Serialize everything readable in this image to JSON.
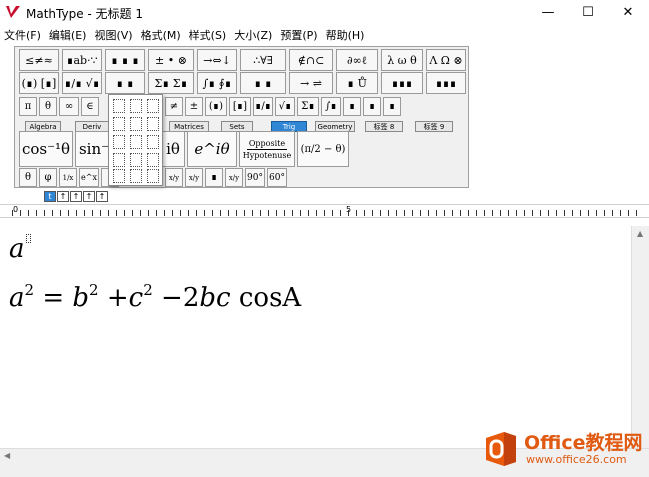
{
  "window": {
    "title": "MathType - 无标题 1",
    "minimize_glyph": "—",
    "maximize_glyph": "☐",
    "close_glyph": "✕"
  },
  "menu": [
    "文件(F)",
    "编辑(E)",
    "视图(V)",
    "格式(M)",
    "样式(S)",
    "大小(Z)",
    "预置(P)",
    "帮助(H)"
  ],
  "palette_row1": [
    "≤≠≈",
    "∎ab·∵",
    "∎ ∎ ∎",
    "± • ⊗",
    "→⇔↓",
    "∴∀∃",
    "∉∩⊂",
    "∂∞ℓ",
    "λ ω θ",
    "Λ Ω ⊗"
  ],
  "palette_row2": [
    "(∎) [∎]",
    "∎/∎ √∎",
    "∎ ∎",
    "Σ∎ Σ∎",
    "∫∎ ∮∎",
    "∎ ∎",
    "→ ⇌",
    "∎ Ů",
    "∎∎∎",
    "∎∎∎"
  ],
  "palette_row3": [
    "π",
    "θ",
    "∞",
    "∈",
    "≠",
    "±",
    "(∎)",
    "[∎]",
    "∎/∎",
    "√∎",
    "Σ∎",
    "∫∎",
    "∎",
    "∎",
    "∎"
  ],
  "tabs": [
    "Algebra",
    "Deriv",
    "Matrices",
    "Sets",
    "Trig",
    "Geometry",
    "标签 8",
    "标签 9"
  ],
  "active_tab": "Trig",
  "template_row": {
    "cos_inv": "cos⁻¹θ",
    "sin_inv": "sin⁻¹",
    "i_theta": "iθ",
    "e_i_theta": "e^iθ",
    "opposite": "Opposite",
    "hypotenuse": "Hypotenuse",
    "pi_half_minus_theta": "(π/2 − θ)"
  },
  "small_row": [
    "θ",
    "φ",
    "1/x",
    "e^x",
    "∎",
    "x/y",
    "x/y",
    "∎",
    "x/y",
    "90°",
    "60°"
  ],
  "size_buttons": [
    "t",
    "↑",
    "↑",
    "↑",
    "↑"
  ],
  "ruler": {
    "mark_0": "0",
    "mark_5": "5"
  },
  "document": {
    "line1_base": "a",
    "line2": {
      "a": "a",
      "b": "b",
      "c": "c",
      "two": "2",
      "eq": "=",
      "plus": "+",
      "minus": "−",
      "coef": "2",
      "bc": "bc",
      "func": "cos",
      "A": "A"
    }
  },
  "watermark": {
    "name": "Office教程网",
    "url": "www.office26.com"
  },
  "colors": {
    "accent_blue": "#2f86d4",
    "logo_red": "#c8102e",
    "watermark_orange": "#e05a12"
  }
}
